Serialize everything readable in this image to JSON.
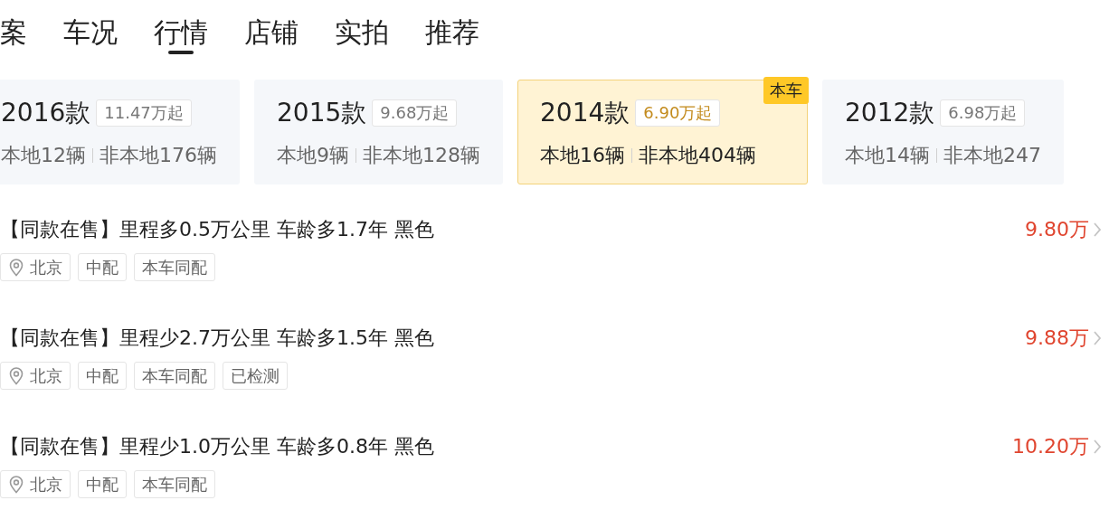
{
  "tabs": [
    {
      "label": "案",
      "selected": false
    },
    {
      "label": "车况",
      "selected": false
    },
    {
      "label": "行情",
      "selected": true
    },
    {
      "label": "店铺",
      "selected": false
    },
    {
      "label": "实拍",
      "selected": false
    },
    {
      "label": "推荐",
      "selected": false
    }
  ],
  "model_years": [
    {
      "year": "2016款",
      "price": "11.47万起",
      "local": "本地12辆",
      "nonlocal": "非本地176辆",
      "selected": false
    },
    {
      "year": "2015款",
      "price": "9.68万起",
      "local": "本地9辆",
      "nonlocal": "非本地128辆",
      "selected": false
    },
    {
      "year": "2014款",
      "price": "6.90万起",
      "local": "本地16辆",
      "nonlocal": "非本地404辆",
      "selected": true,
      "badge": "本车"
    },
    {
      "year": "2012款",
      "price": "6.98万起",
      "local": "本地14辆",
      "nonlocal": "非本地247",
      "selected": false
    }
  ],
  "listings": [
    {
      "title": "【同款在售】里程多0.5万公里 车龄多1.7年 黑色",
      "price": "9.80万",
      "tags": [
        {
          "kind": "location",
          "label": "北京"
        },
        {
          "kind": "plain",
          "label": "中配"
        },
        {
          "kind": "plain",
          "label": "本车同配"
        }
      ]
    },
    {
      "title": "【同款在售】里程少2.7万公里 车龄多1.5年 黑色",
      "price": "9.88万",
      "tags": [
        {
          "kind": "location",
          "label": "北京"
        },
        {
          "kind": "plain",
          "label": "中配"
        },
        {
          "kind": "plain",
          "label": "本车同配"
        },
        {
          "kind": "plain",
          "label": "已检测"
        }
      ]
    },
    {
      "title": "【同款在售】里程少1.0万公里 车龄多0.8年 黑色",
      "price": "10.20万",
      "tags": [
        {
          "kind": "location",
          "label": "北京"
        },
        {
          "kind": "plain",
          "label": "中配"
        },
        {
          "kind": "plain",
          "label": "本车同配"
        }
      ]
    }
  ]
}
